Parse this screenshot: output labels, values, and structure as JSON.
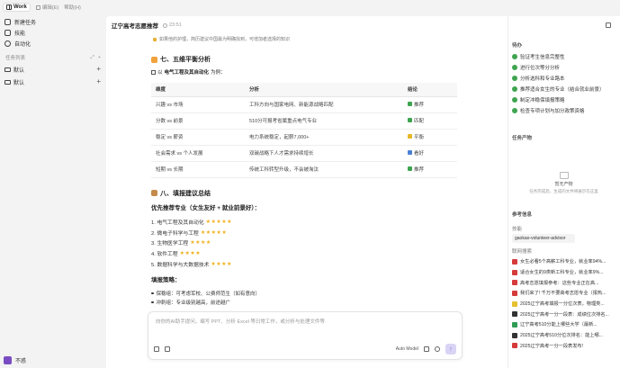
{
  "topbar": {
    "work_label": "Work",
    "tab2_label": "编辑(E)",
    "tab3_label": "帮助(H)"
  },
  "sidebar": {
    "nav": [
      {
        "label": "新建任务"
      },
      {
        "label": "技能"
      },
      {
        "label": "自动化"
      }
    ],
    "section_label": "任务列表",
    "folders": [
      {
        "label": "默认"
      },
      {
        "label": "默认"
      }
    ],
    "user_name": "不惑"
  },
  "main": {
    "title": "辽宁高考志愿推荐",
    "time": "23:51",
    "tip": "如果他的护理，简历建议中国最为明确找到，可增加者选择的知识",
    "section7_title": "七、五维平衡分析",
    "section7_sub_prefix": "以",
    "section7_sub_bold": "电气工程及其自动化",
    "section7_sub_suffix": "为例：",
    "table": {
      "headers": [
        "维度",
        "分析",
        "结论"
      ],
      "rows": [
        {
          "dim": "兴趣 vs 市场",
          "analysis": "工科方向与国家电网、新能源战略匹配",
          "conclusion": "推荐",
          "color": "green"
        },
        {
          "dim": "分数 vs 前景",
          "analysis": "510分可报考省属重点电气专业",
          "conclusion": "匹配",
          "color": "green"
        },
        {
          "dim": "稳定 vs 薪资",
          "analysis": "电力系统稳定，起薪7,000+",
          "conclusion": "平衡",
          "color": "yellow"
        },
        {
          "dim": "社会需求 vs 个人发展",
          "analysis": "双碳战略下人才需求持续增长",
          "conclusion": "看好",
          "color": "blue"
        },
        {
          "dim": "短期 vs 长期",
          "analysis": "传统工科转型升级，不会被淘汰",
          "conclusion": "推荐",
          "color": "green"
        }
      ]
    },
    "section8_title": "八、填报建议总结",
    "priority_title": "优先推荐专业（女生友好 + 就业前景好）：",
    "majors": [
      {
        "label": "1. 电气工程及其自动化",
        "stars": "★★★★★"
      },
      {
        "label": "2. 微电子科学与工程",
        "stars": "★★★★★"
      },
      {
        "label": "3. 生物医学工程",
        "stars": "★★★★"
      },
      {
        "label": "4. 软件工程",
        "stars": "★★★★"
      },
      {
        "label": "5. 数据科学与大数据技术",
        "stars": "★★★★"
      }
    ],
    "strategy_title": "填报策略：",
    "strategy": [
      {
        "label": "保稳组：可考虑军校、公费师范生（如有意向）"
      },
      {
        "label": "冲刺组：专业级别越高，前途越广"
      }
    ]
  },
  "composer": {
    "placeholder": "向你的AI助手提问，编写 PPT、分析 Excel 等日常工作，或分析与处理文件等",
    "model": "Auto Model",
    "send": "↑"
  },
  "right": {
    "todo_title": "待办",
    "todos": [
      {
        "label": "验证考生信息完整性"
      },
      {
        "label": "进行位次等分分析"
      },
      {
        "label": "分析选科和专业路本"
      },
      {
        "label": "推荐适合女生的专业（结合就业前景）"
      },
      {
        "label": "制定冲稳保填报策略"
      },
      {
        "label": "检查专项计划与加分政策资格"
      }
    ],
    "products_title": "任务产物",
    "empty_title": "暂无产物",
    "empty_sub": "任务完成后，生成的文件将展示在这里",
    "refs_title": "参考信息",
    "skills_label": "技能",
    "skill_link": "gaokao-volunteer-advisor",
    "links_label": "联网搜索",
    "refs": [
      {
        "label": "女生必看5个高薪工科专业，就业率94%...",
        "color": "red"
      },
      {
        "label": "适合女生的9类新工科专业，就业率9%...",
        "color": "red"
      },
      {
        "label": "高考志愿填报参考：这些专业正在高... ",
        "color": "red"
      },
      {
        "label": "我们来了! 千万不要高考志愿专业（报热...",
        "color": "red"
      },
      {
        "label": "2025辽宁高考填报一分位次表，物理类...",
        "color": "yellow"
      },
      {
        "label": "2025辽宁高考一分一段表：成绩位次排名...",
        "color": "dark"
      },
      {
        "label": "辽宁高考510分能上哪些大学（最新...",
        "color": "green"
      },
      {
        "label": "2025辽宁高考510分位次排名：能上哪...",
        "color": "dark"
      },
      {
        "label": "2025辽宁高考一分一段表发布!",
        "color": "red"
      }
    ]
  }
}
